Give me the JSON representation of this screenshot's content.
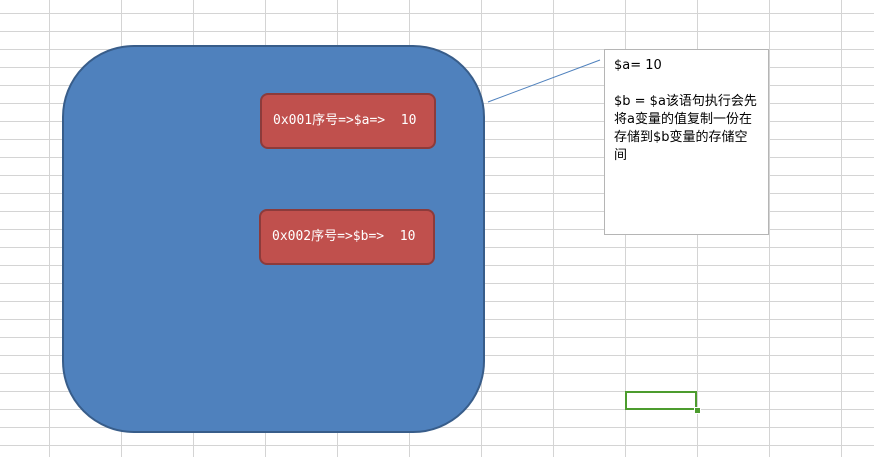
{
  "colors": {
    "memory_block_fill": "#4f81bd",
    "memory_block_border": "#385d8a",
    "variable_box_fill": "#c0504d",
    "callout_connector": "#4f81bd",
    "selection": "#4c9c2e"
  },
  "variables": [
    {
      "text": "0x001序号=>$a=>  10"
    },
    {
      "text": "0x002序号=>$b=>  10"
    }
  ],
  "callout": {
    "line1": "$a= 10",
    "line2": "$b = $a该语句执行会先将a变量的值复制一份在存储到$b变量的存储空间"
  }
}
